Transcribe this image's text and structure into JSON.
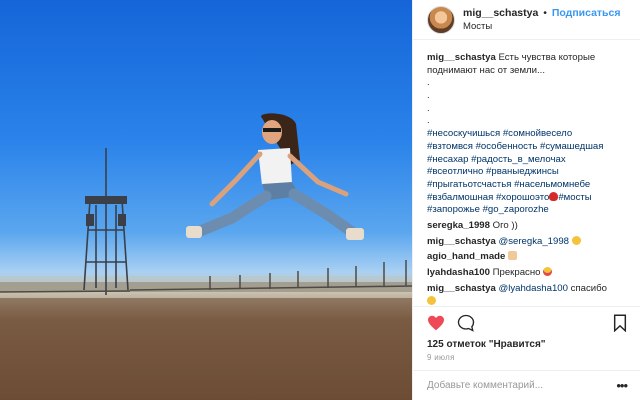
{
  "header": {
    "username": "mig__schastya",
    "separator": "•",
    "follow_label": "Подписаться",
    "location": "Мосты"
  },
  "caption": {
    "username": "mig__schastya",
    "text": "Есть чувства которые поднимают нас от земли...",
    "dots": [
      ".",
      ".",
      ".",
      "."
    ],
    "hashtags": [
      "#несоскучишься",
      "#сомнойвесело",
      "#взтомвся",
      "#особенность",
      "#сумашедшая",
      "#несахар",
      "#радость_в_мелочах",
      "#всеотлично",
      "#рваныеджинсы",
      "#прыгатьотсчастья",
      "#насельмомнебе",
      "#взбалмошная",
      "#хорошоэто",
      "#мосты",
      "#запорожье",
      "#go_zaporozhe"
    ]
  },
  "comments": [
    {
      "user": "seregka_1998",
      "mention": "",
      "text": "Ого ))",
      "emoji": ""
    },
    {
      "user": "mig__schastya",
      "mention": "@seregka_1998",
      "text": "",
      "emoji": "smile"
    },
    {
      "user": "agio_hand_made",
      "mention": "",
      "text": "",
      "emoji": "thumbs-up"
    },
    {
      "user": "lyahdasha100",
      "mention": "",
      "text": "Прекрасно",
      "emoji": "heart-eyes"
    },
    {
      "user": "mig__schastya",
      "mention": "@lyahdasha100",
      "text": "спасибо",
      "emoji": "smile"
    }
  ],
  "actions": {
    "likes_label": "125 отметок \"Нравится\"",
    "date": "9 июля"
  },
  "add_comment": {
    "placeholder": "Добавьте комментарий...",
    "more_label": "•••"
  },
  "colors": {
    "link": "#003569",
    "follow": "#3897f0",
    "heart": "#ed4956"
  }
}
